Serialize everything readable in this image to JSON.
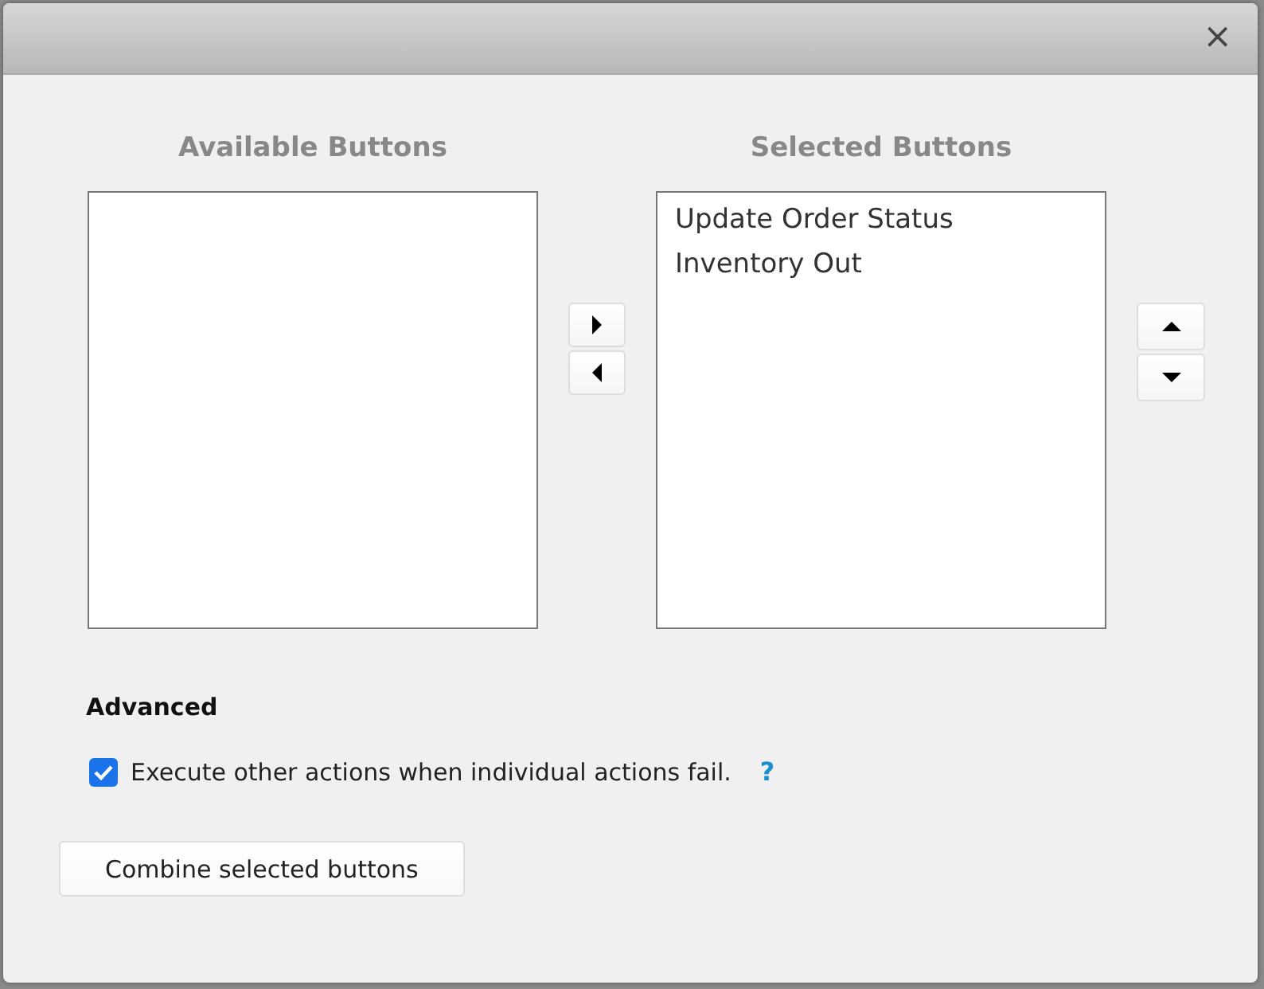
{
  "dialog": {
    "close": "×"
  },
  "available": {
    "heading": "Available Buttons"
  },
  "selected": {
    "heading": "Selected Buttons",
    "items": [
      {
        "label": "Update Order Status",
        "selected": false
      },
      {
        "label": "Inventory Out",
        "selected": false
      }
    ]
  },
  "advanced": {
    "heading": "Advanced",
    "option": {
      "label": "Execute other actions when individual actions fail.",
      "checked": true
    },
    "help": "?"
  },
  "buttons": [
    {
      "label": "Combine selected buttons"
    }
  ]
}
